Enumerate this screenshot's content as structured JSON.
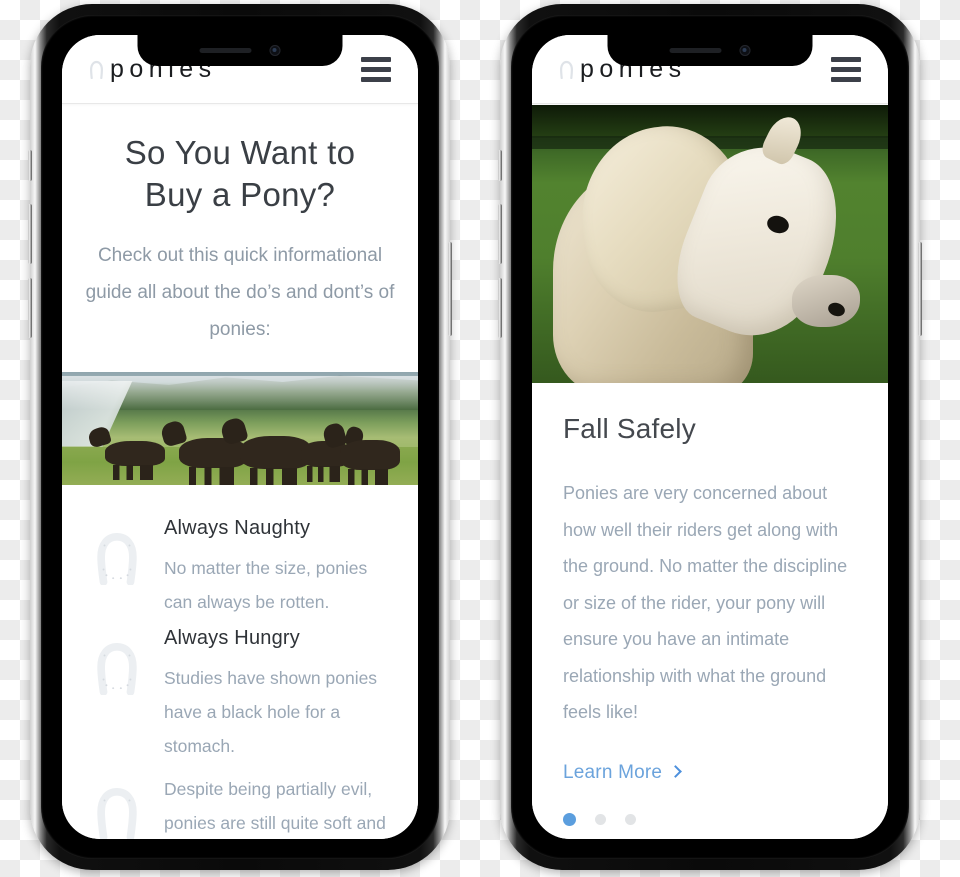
{
  "site": {
    "logo_shoe_icon": "horseshoe-icon",
    "logo_text": "ponies",
    "menu_icon": "hamburger-menu-icon"
  },
  "phone_left": {
    "hero": {
      "title": "So You Want to Buy a Pony?",
      "subtitle": "Check out this quick informational guide all about the do’s and dont’s of ponies:"
    },
    "hero_image_alt": "herd-of-exmoor-ponies-on-coastal-hillside",
    "features": [
      {
        "icon": "horseshoe-icon",
        "title": "Always Naughty",
        "text": "No matter the size, ponies can always be rotten."
      },
      {
        "icon": "horseshoe-icon",
        "title": "Always Hungry",
        "text": "Studies have shown ponies have a black hole for a stomach."
      },
      {
        "icon": "horseshoe-icon",
        "title": "",
        "text": "Despite being partially evil, ponies are still quite soft and"
      }
    ]
  },
  "phone_right": {
    "card_image_alt": "white-shetland-pony-head-in-green-field",
    "card": {
      "title": "Fall Safely",
      "text": "Ponies are very concerned about how well their riders get along with the ground. No matter the discipline or size of the rider, your pony will ensure you have an intimate relationship with what the ground feels like!",
      "link_label": "Learn More",
      "link_chevron_icon": "chevron-right-icon"
    },
    "carousel": {
      "total": 3,
      "active_index": 0
    }
  },
  "colors": {
    "heading": "#2f3338",
    "body_text": "#9aa7b5",
    "accent_blue": "#5b9ede",
    "link_blue": "#6ba3dc",
    "hamburger": "#3c4049",
    "horseshoe": "#e9ecef"
  }
}
